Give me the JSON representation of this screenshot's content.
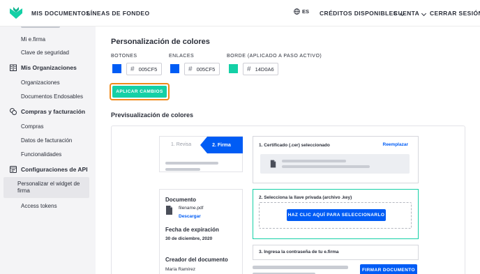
{
  "colors": {
    "brand": "#14d0a6",
    "primary": "#005cf5",
    "focus_ring": "#f08a1a",
    "sidebar_bg": "#f4f4f6"
  },
  "topbar": {
    "logo_icon": "brand-logo-icon",
    "nav": [
      "MIS DOCUMENTOS",
      "LÍNEAS DE FONDEO"
    ],
    "language": "ES",
    "credits": "CRÉDITOS DISPONIBLES",
    "account": "CUENTA",
    "logout": "CERRAR SESIÓN"
  },
  "sidebar": {
    "items_top": [
      "Mi e.firma",
      "Clave de seguridad"
    ],
    "section_orgs": "Mis Organizaciones",
    "orgs_items": [
      "Organizaciones",
      "Documentos Endosables"
    ],
    "section_billing": "Compras y facturación",
    "billing_items": [
      "Compras",
      "Datos de facturación",
      "Funcionalidades"
    ],
    "section_api": "Configuraciones de API",
    "api_items": [
      "Personalizar el widget de firma",
      "Access tokens"
    ]
  },
  "main": {
    "title": "Personalización de colores",
    "fields": [
      {
        "label": "BOTONES",
        "value": "005CF5",
        "color": "#005cf5"
      },
      {
        "label": "ENLACES",
        "value": "005CF5",
        "color": "#005cf5"
      },
      {
        "label": "BORDE (APLICADO A PASO ACTIVO)",
        "value": "14D0A6",
        "color": "#14d0a6"
      }
    ],
    "apply_label": "APLICAR CAMBIOS",
    "preview_title": "Previsualización de colores"
  },
  "preview": {
    "steps": [
      "1. Revisa",
      "2. Firma"
    ],
    "document_title": "Documento",
    "file_name": "filename.pdf",
    "download": "Descargar",
    "expiration_title": "Fecha de expiración",
    "expiration_date": "30 de diciembre, 2020",
    "creator_title": "Creador del documento",
    "creator_name": "María Ramírez",
    "cert_title": "1. Certificado (.cer) seleccionado",
    "replace": "Reemplazar",
    "key_title": "2. Selecciona la llave privada (archivo .key)",
    "key_button": "HAZ CLIC AQUÍ PARA SELECCIONARLO",
    "password_title": "3. Ingresa la contraseña de tu e.firma",
    "sign_button": "FIRMAR DOCUMENTO"
  }
}
